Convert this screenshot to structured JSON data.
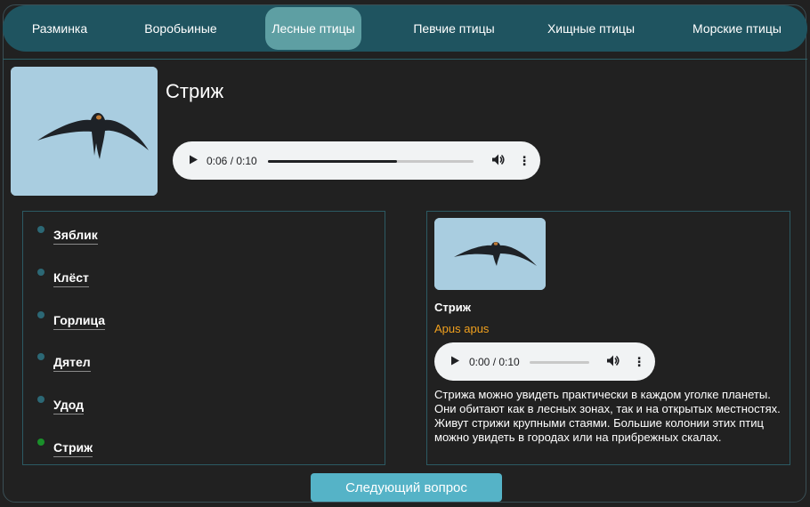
{
  "nav": {
    "items": [
      {
        "label": "Разминка"
      },
      {
        "label": "Воробьиные"
      },
      {
        "label": "Лесные птицы"
      },
      {
        "label": "Певчие птицы"
      },
      {
        "label": "Хищные птицы"
      },
      {
        "label": "Морские птицы"
      }
    ],
    "active_index": 2
  },
  "question": {
    "title": "Стриж",
    "image_icon": "swift-bird-photo",
    "audio": {
      "time": "0:06 / 0:10",
      "progress": 0.6
    }
  },
  "answers": {
    "items": [
      {
        "label": "Зяблик",
        "state": "unanswered"
      },
      {
        "label": "Клёст",
        "state": "unanswered"
      },
      {
        "label": "Горлица",
        "state": "unanswered"
      },
      {
        "label": "Дятел",
        "state": "unanswered"
      },
      {
        "label": "Удод",
        "state": "unanswered"
      },
      {
        "label": "Стриж",
        "state": "correct"
      }
    ]
  },
  "details": {
    "image_icon": "swift-bird-photo",
    "name": "Стриж",
    "latin": "Apus apus",
    "audio": {
      "time": "0:00 / 0:10",
      "progress": 0.0
    },
    "description": "Стрижа можно увидеть практически в каждом уголке планеты. Они обитают как в лесных зонах, так и на открытых местностях. Живут стрижи крупными стаями. Большие колонии этих птиц можно увидеть в городах или на прибрежных скалах."
  },
  "next_button": {
    "label": "Следующий вопрос"
  },
  "colors": {
    "background": "#212121",
    "nav_bg": "#1f5460",
    "nav_active": "#5e9fa3",
    "accent": "#55b3c7",
    "latin_name": "#f0a01e",
    "correct_dot": "#1a8f2a",
    "neutral_dot": "#2c6875"
  }
}
